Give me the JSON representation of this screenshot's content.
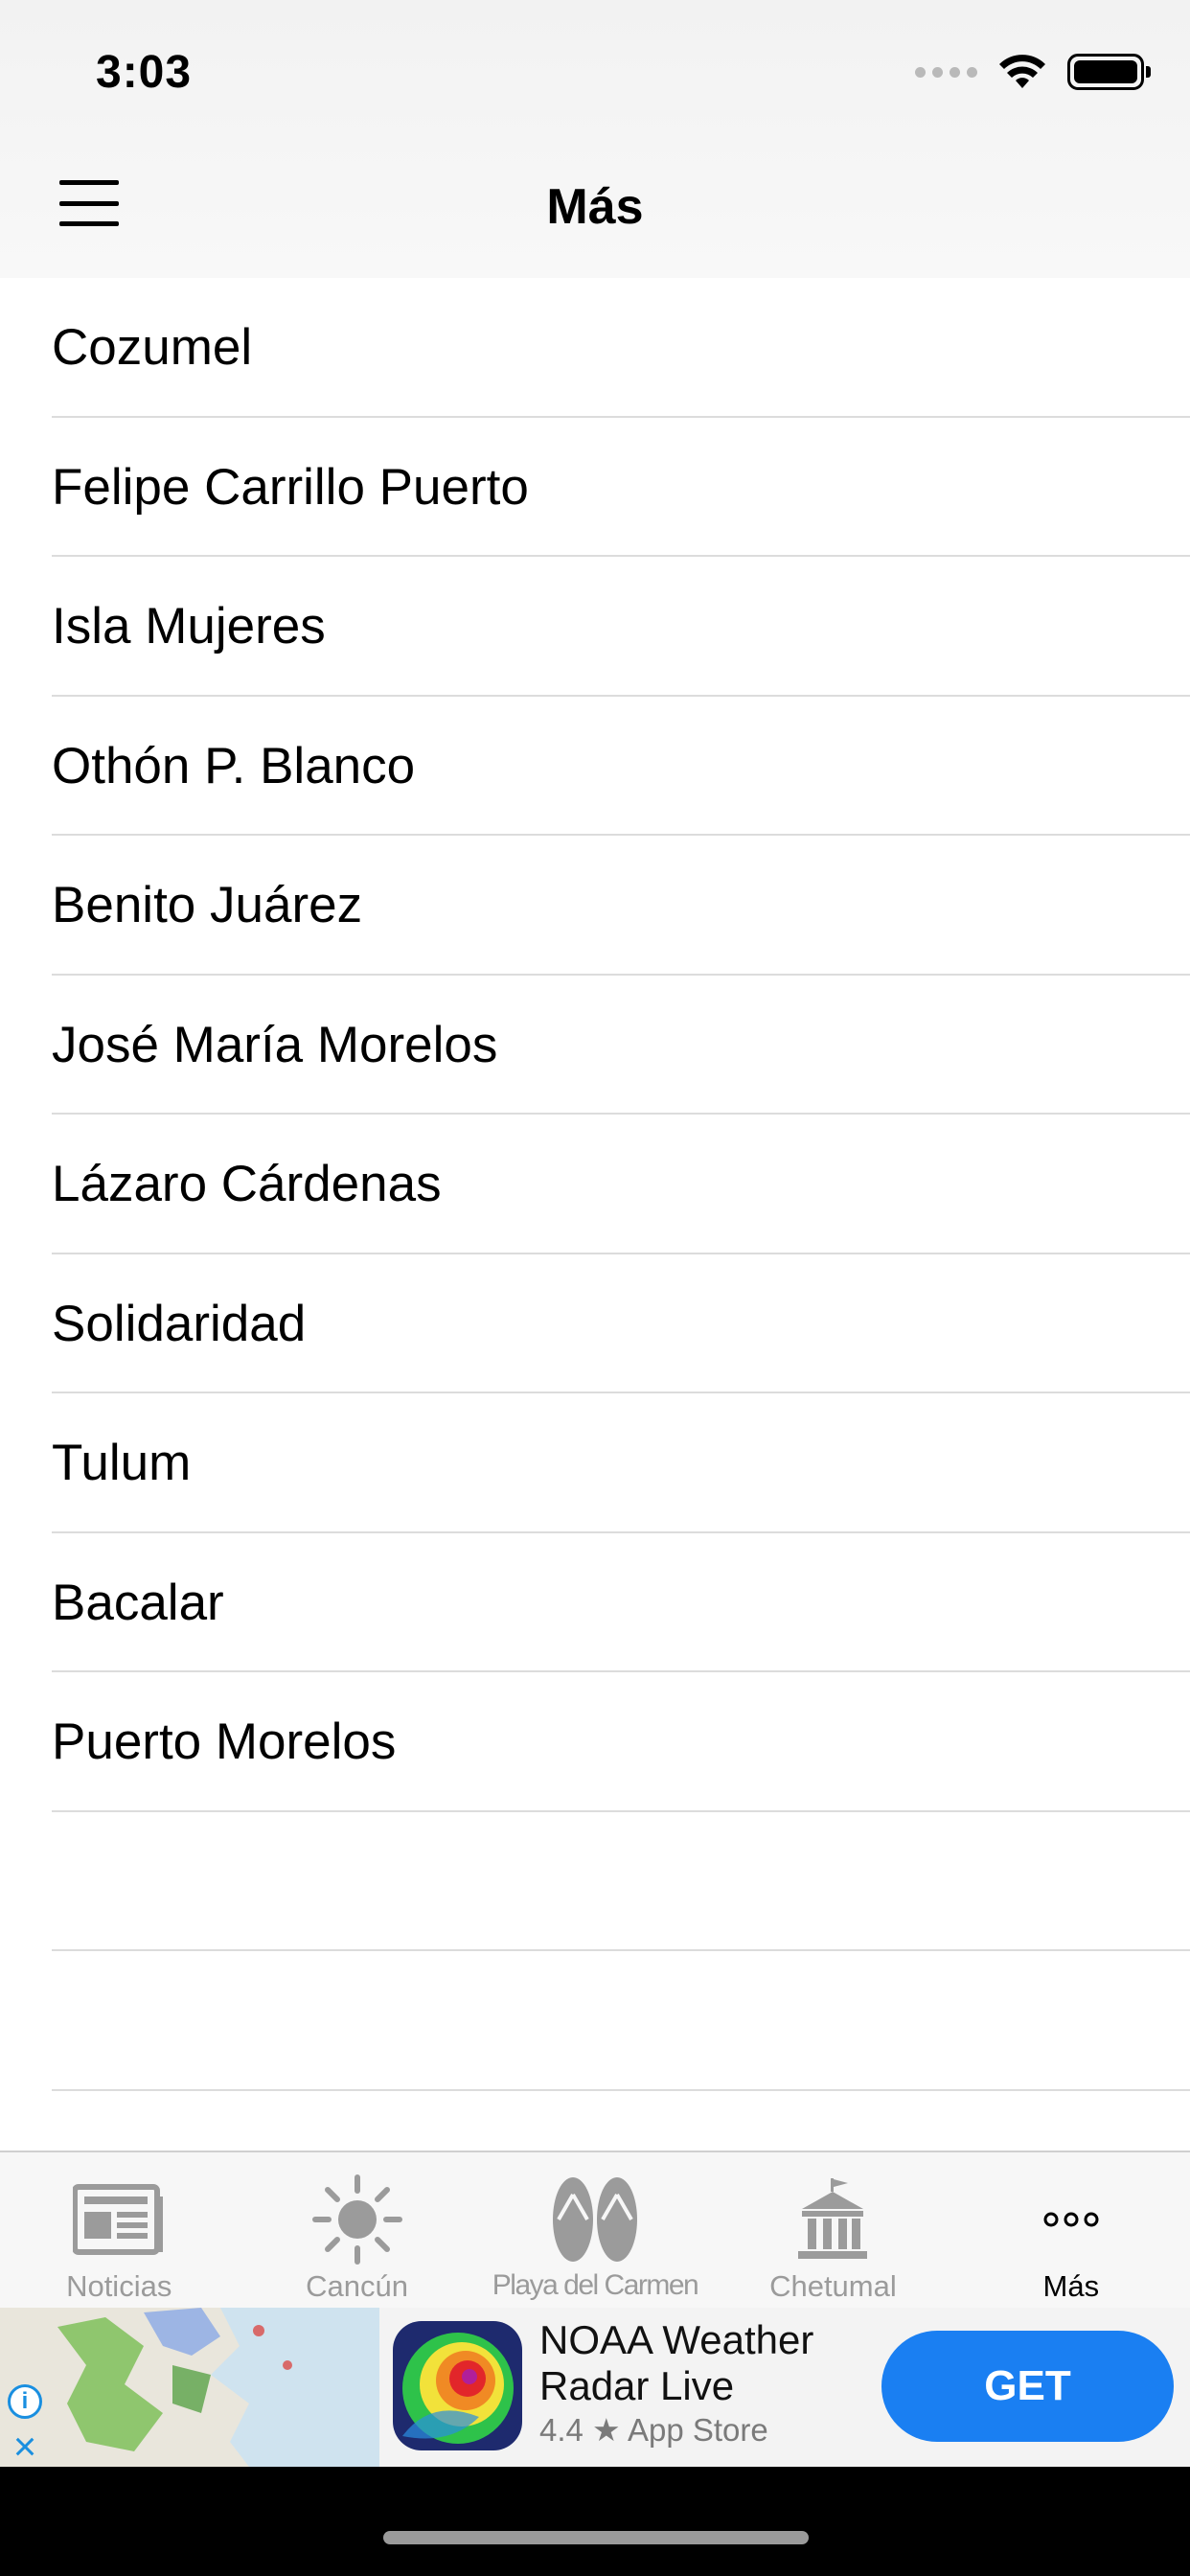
{
  "status_bar": {
    "time": "3:03"
  },
  "nav": {
    "title": "Más"
  },
  "list": {
    "items": [
      "Cozumel",
      "Felipe Carrillo Puerto",
      "Isla Mujeres",
      "Othón P. Blanco",
      "Benito Juárez",
      "José María Morelos",
      "Lázaro Cárdenas",
      "Solidaridad",
      "Tulum",
      "Bacalar",
      "Puerto Morelos"
    ]
  },
  "tabs": [
    {
      "label": "Noticias",
      "icon": "newspaper-icon"
    },
    {
      "label": "Cancún",
      "icon": "sun-icon"
    },
    {
      "label": "Playa del Carmen",
      "icon": "flip-flops-icon"
    },
    {
      "label": "Chetumal",
      "icon": "monument-icon"
    },
    {
      "label": "Más",
      "icon": "more-icon"
    }
  ],
  "active_tab": "Más",
  "ad": {
    "title": "NOAA Weather Radar Live",
    "rating": "4.4 ★ App Store",
    "cta": "GET"
  },
  "colors": {
    "accent": "#1a7ff2",
    "tab_inactive": "#9b9b9b",
    "separator": "#dcdcdc"
  }
}
